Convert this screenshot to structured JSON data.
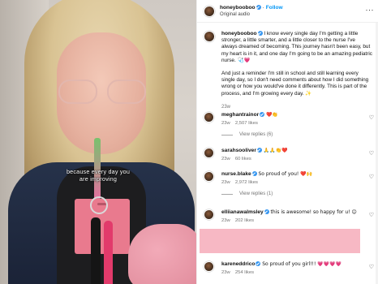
{
  "media": {
    "overlay_line1": "because every day you",
    "overlay_line2": "are improving"
  },
  "header": {
    "username": "honeybooboo",
    "follow_label": "Follow",
    "audio": "Original audio",
    "more_icon": "more-horizontal-icon"
  },
  "caption": {
    "username": "honeybooboo",
    "para1": "I know every single day I'm getting a little stronger, a little smarter, and a little closer to the nurse I've always dreamed of becoming. This journey hasn't been easy, but my heart is in it, and one day I'm going to be an amazing pediatric nurse. 🩺💗",
    "para2": "And just a reminder I'm still in school and still learning every single day, so I don't need comments about how I did something wrong or how you would've done it differently. This is part of the process, and I'm growing every day. ✨",
    "time": "23w"
  },
  "comments": [
    {
      "username": "meghantrainor",
      "text": "❤️👏",
      "time": "23w",
      "likes": "2,507 likes",
      "replies": "View replies (6)"
    },
    {
      "username": "sarahsooliver",
      "text": "🙏🙏👏❤️",
      "time": "23w",
      "likes": "60 likes",
      "replies": ""
    },
    {
      "username": "nurse.blake",
      "text": "So proud of you! ❤️🙌",
      "time": "23w",
      "likes": "2,972 likes",
      "replies": "View replies (1)"
    },
    {
      "username": "elliianawalmsley",
      "text": "this is awesome! so happy for u! 😊",
      "time": "23w",
      "likes": "202 likes",
      "replies": ""
    },
    {
      "username": "kareneddrico",
      "text": "So proud of you girl!!! 💗💗💗💗",
      "time": "23w",
      "likes": "254 likes",
      "replies": ""
    }
  ],
  "colors": {
    "accent": "#0095f6",
    "verified": "#3897f0",
    "muted": "#737373",
    "pink_block": "#f7b8c4"
  }
}
